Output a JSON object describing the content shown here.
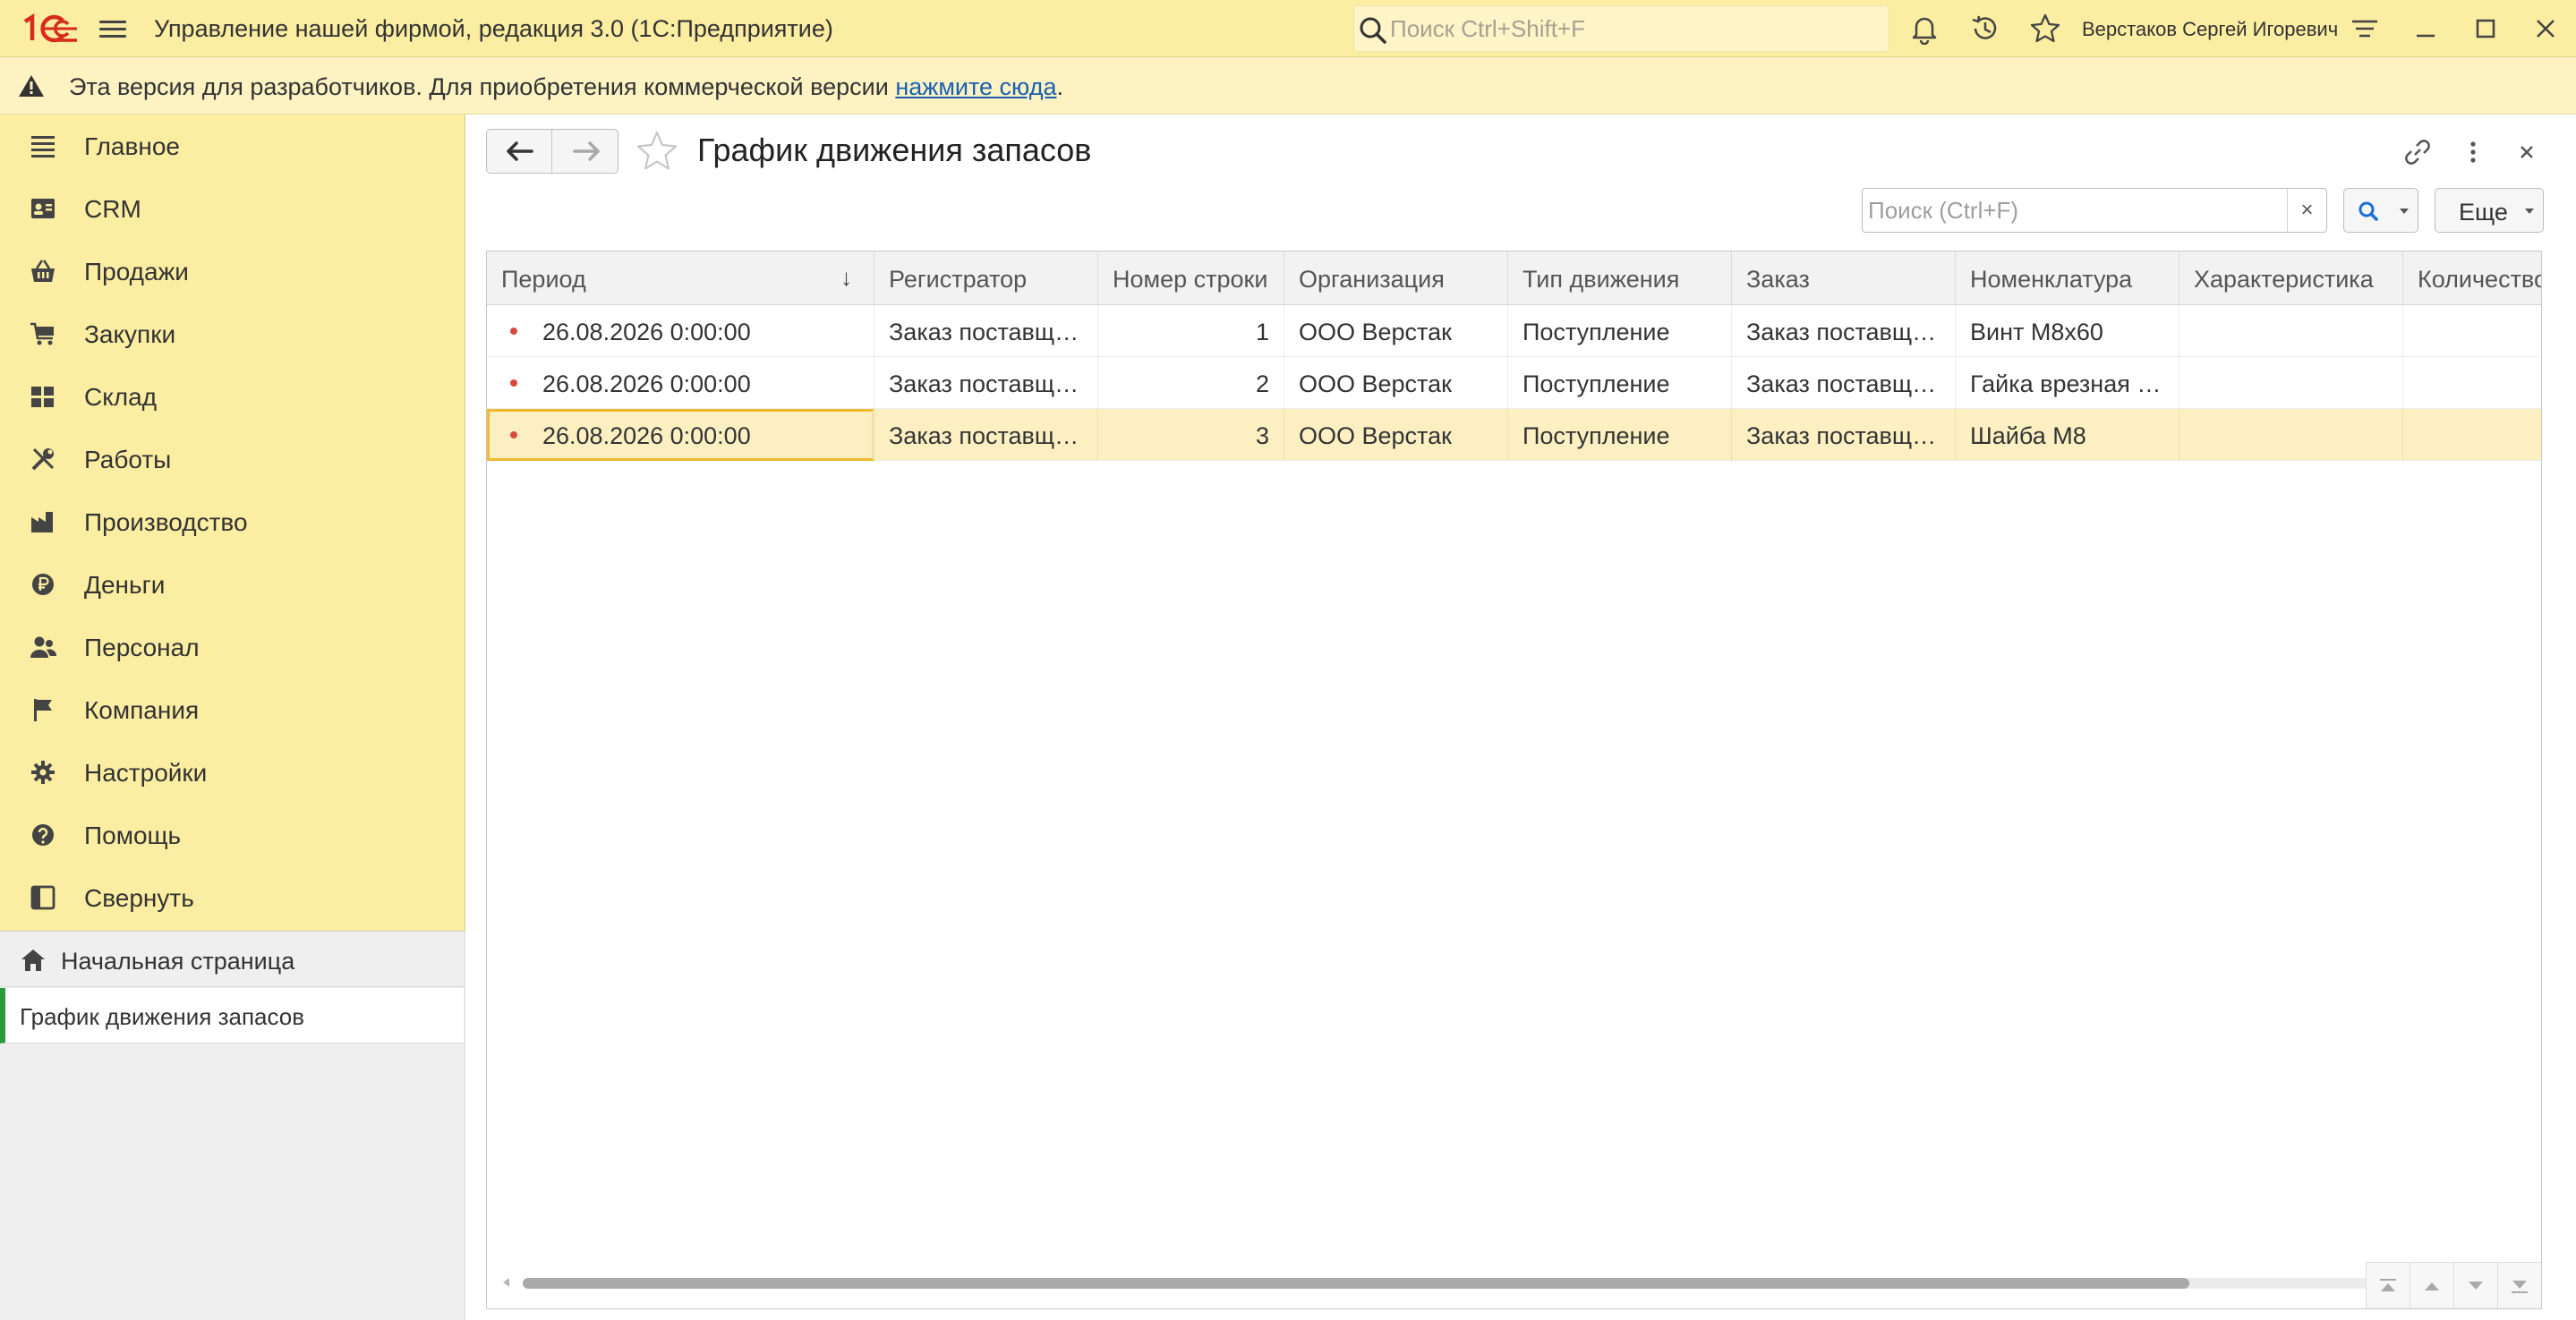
{
  "app": {
    "title": "Управление нашей фирмой, редакция 3.0  (1С:Предприятие)",
    "search_placeholder": "Поиск Ctrl+Shift+F",
    "user_name": "Верстаков Сергей Игоревич"
  },
  "banner": {
    "text": "Эта версия для разработчиков. Для приобретения коммерческой версии ",
    "link": "нажмите сюда",
    "tail": "."
  },
  "sidebar": {
    "items": [
      {
        "label": "Главное",
        "icon": "list-icon"
      },
      {
        "label": "CRM",
        "icon": "contact-card-icon"
      },
      {
        "label": "Продажи",
        "icon": "basket-icon"
      },
      {
        "label": "Закупки",
        "icon": "cart-icon"
      },
      {
        "label": "Склад",
        "icon": "warehouse-icon"
      },
      {
        "label": "Работы",
        "icon": "tools-icon"
      },
      {
        "label": "Производство",
        "icon": "factory-icon"
      },
      {
        "label": "Деньги",
        "icon": "ruble-icon"
      },
      {
        "label": "Персонал",
        "icon": "people-icon"
      },
      {
        "label": "Компания",
        "icon": "flag-icon"
      },
      {
        "label": "Настройки",
        "icon": "gear-icon"
      },
      {
        "label": "Помощь",
        "icon": "help-icon"
      },
      {
        "label": "Свернуть",
        "icon": "collapse-icon"
      }
    ],
    "home_label": "Начальная страница",
    "open_tab_label": "График движения запасов"
  },
  "form": {
    "title": "График движения запасов",
    "search_placeholder": "Поиск (Ctrl+F)",
    "clear_label": "×",
    "more_label": "Еще"
  },
  "table": {
    "columns": [
      {
        "label": "Период",
        "sort": "↓"
      },
      {
        "label": "Регистратор"
      },
      {
        "label": "Номер строки"
      },
      {
        "label": "Организация"
      },
      {
        "label": "Тип движения"
      },
      {
        "label": "Заказ"
      },
      {
        "label": "Номенклатура"
      },
      {
        "label": "Характеристика"
      },
      {
        "label": "Количество"
      }
    ],
    "rows": [
      [
        "26.08.2026 0:00:00",
        "Заказ поставщ…",
        "1",
        "ООО Верстак",
        "Поступление",
        "Заказ поставщ…",
        "Винт М8х60",
        "",
        ""
      ],
      [
        "26.08.2026 0:00:00",
        "Заказ поставщ…",
        "2",
        "ООО Верстак",
        "Поступление",
        "Заказ поставщ…",
        "Гайка врезная …",
        "",
        ""
      ],
      [
        "26.08.2026 0:00:00",
        "Заказ поставщ…",
        "3",
        "ООО Верстак",
        "Поступление",
        "Заказ поставщ…",
        "Шайба М8",
        "",
        ""
      ]
    ],
    "selected_row": 2
  },
  "colors": {
    "panel_yellow": "#fbeda1",
    "banner_yellow": "#fcf2c2",
    "selection": "#fcf0c3",
    "focus_border": "#f0b92e",
    "active_tab_marker": "#2b9a3a",
    "logo_red": "#d92a1c"
  }
}
